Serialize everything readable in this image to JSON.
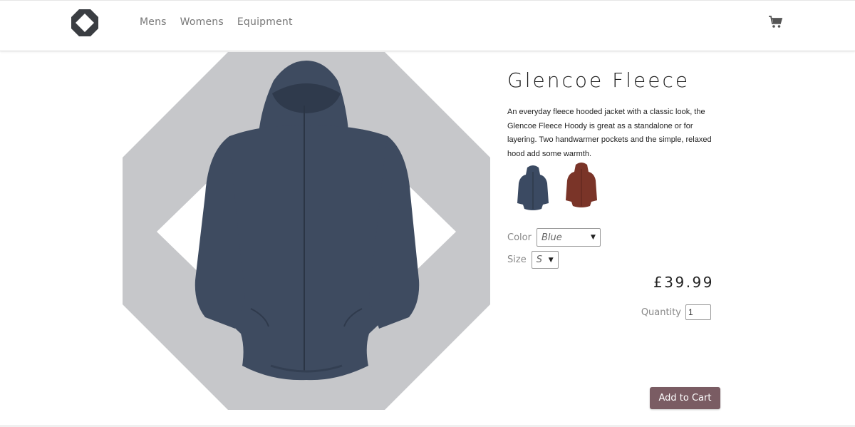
{
  "nav": {
    "logo_icon": "octagon-logo-icon",
    "links": [
      {
        "label": "Mens"
      },
      {
        "label": "Womens"
      },
      {
        "label": "Equipment"
      }
    ],
    "cart_icon": "shopping-cart-icon"
  },
  "product": {
    "title": "Glencoe Fleece",
    "description": "An everyday fleece hooded jacket with a classic look, the Glencoe Fleece Hoody is great as a standalone or for layering.  Two handwarmer pockets and the simple, relaxed hood add some warmth.",
    "swatches": [
      {
        "name": "blue-jacket-thumbnail",
        "color": "#3b4a62"
      },
      {
        "name": "red-jacket-thumbnail",
        "color": "#7a3428"
      }
    ],
    "color_label": "Color",
    "color_value": "Blue",
    "size_label": "Size",
    "size_value": "S",
    "price": "£39.99",
    "quantity_label": "Quantity",
    "quantity_value": "1",
    "add_to_cart": "Add to Cart"
  },
  "colors": {
    "hero_bg": "#c6c7ca",
    "jacket": "#3e4b60",
    "button": "#7a5c63"
  }
}
